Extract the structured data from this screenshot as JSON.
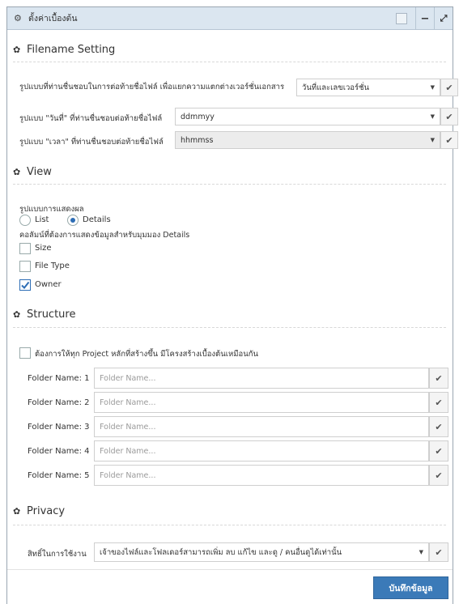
{
  "window": {
    "title": "ตั้งค่าเบื้องต้น"
  },
  "sections": {
    "filename": "Filename Setting",
    "view": "View",
    "structure": "Structure",
    "privacy": "Privacy"
  },
  "filename": {
    "rows": [
      {
        "label": "รูปแบบที่ท่านชื่นชอบในการต่อท้ายชื่อไฟล์ เพื่อแยกความแตกต่างเวอร์ชั่นเอกสาร",
        "value": "วันที่และเลขเวอร์ชั่น"
      },
      {
        "label": "รูปแบบ \"วันที่\" ที่ท่านชื่นชอบต่อท้ายชื่อไฟล์",
        "value": "ddmmyy"
      },
      {
        "label": "รูปแบบ \"เวลา\" ที่ท่านชื่นชอบต่อท้ายชื่อไฟล์",
        "value": "hhmmss"
      }
    ]
  },
  "view": {
    "display_label": "รูปแบบการแสดงผล",
    "radio_list": "List",
    "radio_details": "Details",
    "selected": "Details",
    "columns_label": "คอลัมน์ที่ต้องการแสดงข้อมูลสำหรับมุมมอง Details",
    "options": [
      {
        "label": "Size",
        "checked": false
      },
      {
        "label": "File Type",
        "checked": false
      },
      {
        "label": "Owner",
        "checked": true
      }
    ]
  },
  "structure": {
    "checkbox_label": "ต้องการให้ทุก Project หลักที่สร้างขึ้น มีโครงสร้างเบื้องต้นเหมือนกัน",
    "checked": false,
    "folders": [
      {
        "label": "Folder Name: 1",
        "placeholder": "Folder Name..."
      },
      {
        "label": "Folder Name: 2",
        "placeholder": "Folder Name..."
      },
      {
        "label": "Folder Name: 3",
        "placeholder": "Folder Name..."
      },
      {
        "label": "Folder Name: 4",
        "placeholder": "Folder Name..."
      },
      {
        "label": "Folder Name: 5",
        "placeholder": "Folder Name..."
      }
    ]
  },
  "privacy": {
    "label": "สิทธิ์ในการใช้งาน",
    "value": "เจ้าของไฟล์และโฟลเดอร์สามารถเพิ่ม ลบ แก้ไข และดู / คนอื่นดูได้เท่านั้น"
  },
  "save_label": "บันทึกข้อมูล",
  "colors": {
    "accent": "#2d6db5",
    "titlebar": "#dbe6f0",
    "save_button": "#3b7ab8"
  }
}
